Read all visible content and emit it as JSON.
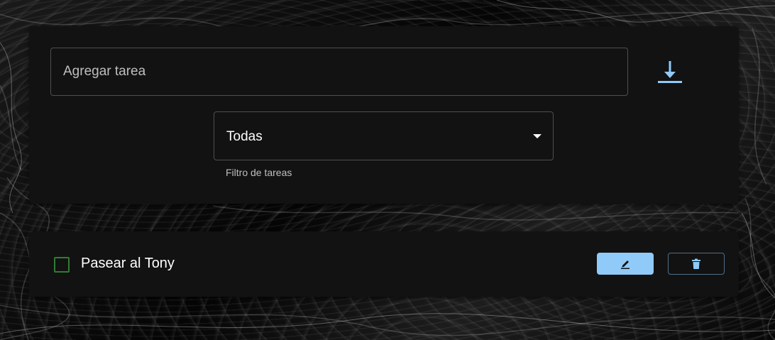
{
  "new_task": {
    "placeholder": "Agregar tarea",
    "save_icon": "download-icon"
  },
  "filter": {
    "selected": "Todas",
    "helper": "Filtro de tareas",
    "caret_icon": "arrow-drop-down-icon"
  },
  "tasks": [
    {
      "text": "Pasear al Tony",
      "completed": false,
      "edit_icon": "edit-icon",
      "delete_icon": "delete-icon"
    }
  ],
  "colors": {
    "accent": "#90caf9",
    "checkbox": "#2e7d32",
    "card": "#121212"
  }
}
